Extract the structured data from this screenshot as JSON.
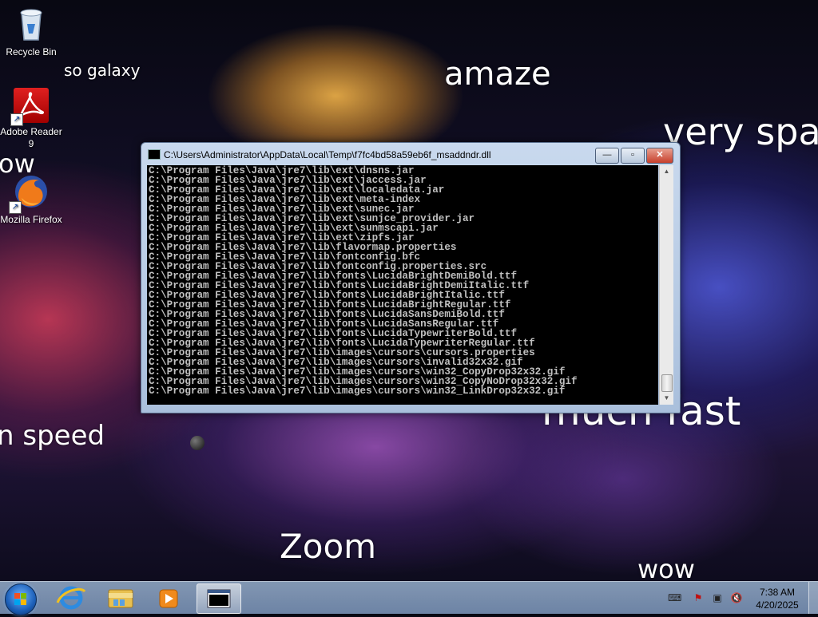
{
  "desktop": {
    "icons": [
      {
        "label": "Recycle Bin",
        "icon": "recycle-bin-icon"
      },
      {
        "label": "Adobe Reader 9",
        "icon": "adobe-reader-icon"
      },
      {
        "label": "Mozilla Firefox",
        "icon": "firefox-icon"
      }
    ],
    "doge_texts": {
      "so_galaxy": "so galaxy",
      "amaze": "amaze",
      "very_sp": "very spa",
      "wow_left": "ow",
      "speed": "n speed",
      "much_fast": "much fast",
      "zoom": "Zoom",
      "wow_bottom": "wow"
    }
  },
  "window": {
    "title": "C:\\Users\\Administrator\\AppData\\Local\\Temp\\f7fc4bd58a59eb6f_msaddndr.dll",
    "buttons": {
      "minimize": "—",
      "maximize": "▫",
      "close": "✕"
    },
    "console_lines": [
      "C:\\Program Files\\Java\\jre7\\lib\\ext\\dnsns.jar",
      "C:\\Program Files\\Java\\jre7\\lib\\ext\\jaccess.jar",
      "C:\\Program Files\\Java\\jre7\\lib\\ext\\localedata.jar",
      "C:\\Program Files\\Java\\jre7\\lib\\ext\\meta-index",
      "C:\\Program Files\\Java\\jre7\\lib\\ext\\sunec.jar",
      "C:\\Program Files\\Java\\jre7\\lib\\ext\\sunjce_provider.jar",
      "C:\\Program Files\\Java\\jre7\\lib\\ext\\sunmscapi.jar",
      "C:\\Program Files\\Java\\jre7\\lib\\ext\\zipfs.jar",
      "C:\\Program Files\\Java\\jre7\\lib\\flavormap.properties",
      "C:\\Program Files\\Java\\jre7\\lib\\fontconfig.bfc",
      "C:\\Program Files\\Java\\jre7\\lib\\fontconfig.properties.src",
      "C:\\Program Files\\Java\\jre7\\lib\\fonts\\LucidaBrightDemiBold.ttf",
      "C:\\Program Files\\Java\\jre7\\lib\\fonts\\LucidaBrightDemiItalic.ttf",
      "C:\\Program Files\\Java\\jre7\\lib\\fonts\\LucidaBrightItalic.ttf",
      "C:\\Program Files\\Java\\jre7\\lib\\fonts\\LucidaBrightRegular.ttf",
      "C:\\Program Files\\Java\\jre7\\lib\\fonts\\LucidaSansDemiBold.ttf",
      "C:\\Program Files\\Java\\jre7\\lib\\fonts\\LucidaSansRegular.ttf",
      "C:\\Program Files\\Java\\jre7\\lib\\fonts\\LucidaTypewriterBold.ttf",
      "C:\\Program Files\\Java\\jre7\\lib\\fonts\\LucidaTypewriterRegular.ttf",
      "C:\\Program Files\\Java\\jre7\\lib\\images\\cursors\\cursors.properties",
      "C:\\Program Files\\Java\\jre7\\lib\\images\\cursors\\invalid32x32.gif",
      "C:\\Program Files\\Java\\jre7\\lib\\images\\cursors\\win32_CopyDrop32x32.gif",
      "C:\\Program Files\\Java\\jre7\\lib\\images\\cursors\\win32_CopyNoDrop32x32.gif",
      "C:\\Program Files\\Java\\jre7\\lib\\images\\cursors\\win32_LinkDrop32x32.gif"
    ]
  },
  "taskbar": {
    "pinned": [
      "internet-explorer-icon",
      "file-explorer-icon",
      "media-player-icon",
      "console-window-icon"
    ],
    "tray": [
      "keyboard-icon",
      "action-center-flag-icon",
      "network-icon",
      "volume-muted-icon"
    ],
    "clock": {
      "time": "7:38 AM",
      "date": "4/20/2025"
    }
  },
  "colors": {
    "console_bg": "#000000",
    "console_text": "#c0c0c0",
    "close_button": "#c7402c"
  }
}
